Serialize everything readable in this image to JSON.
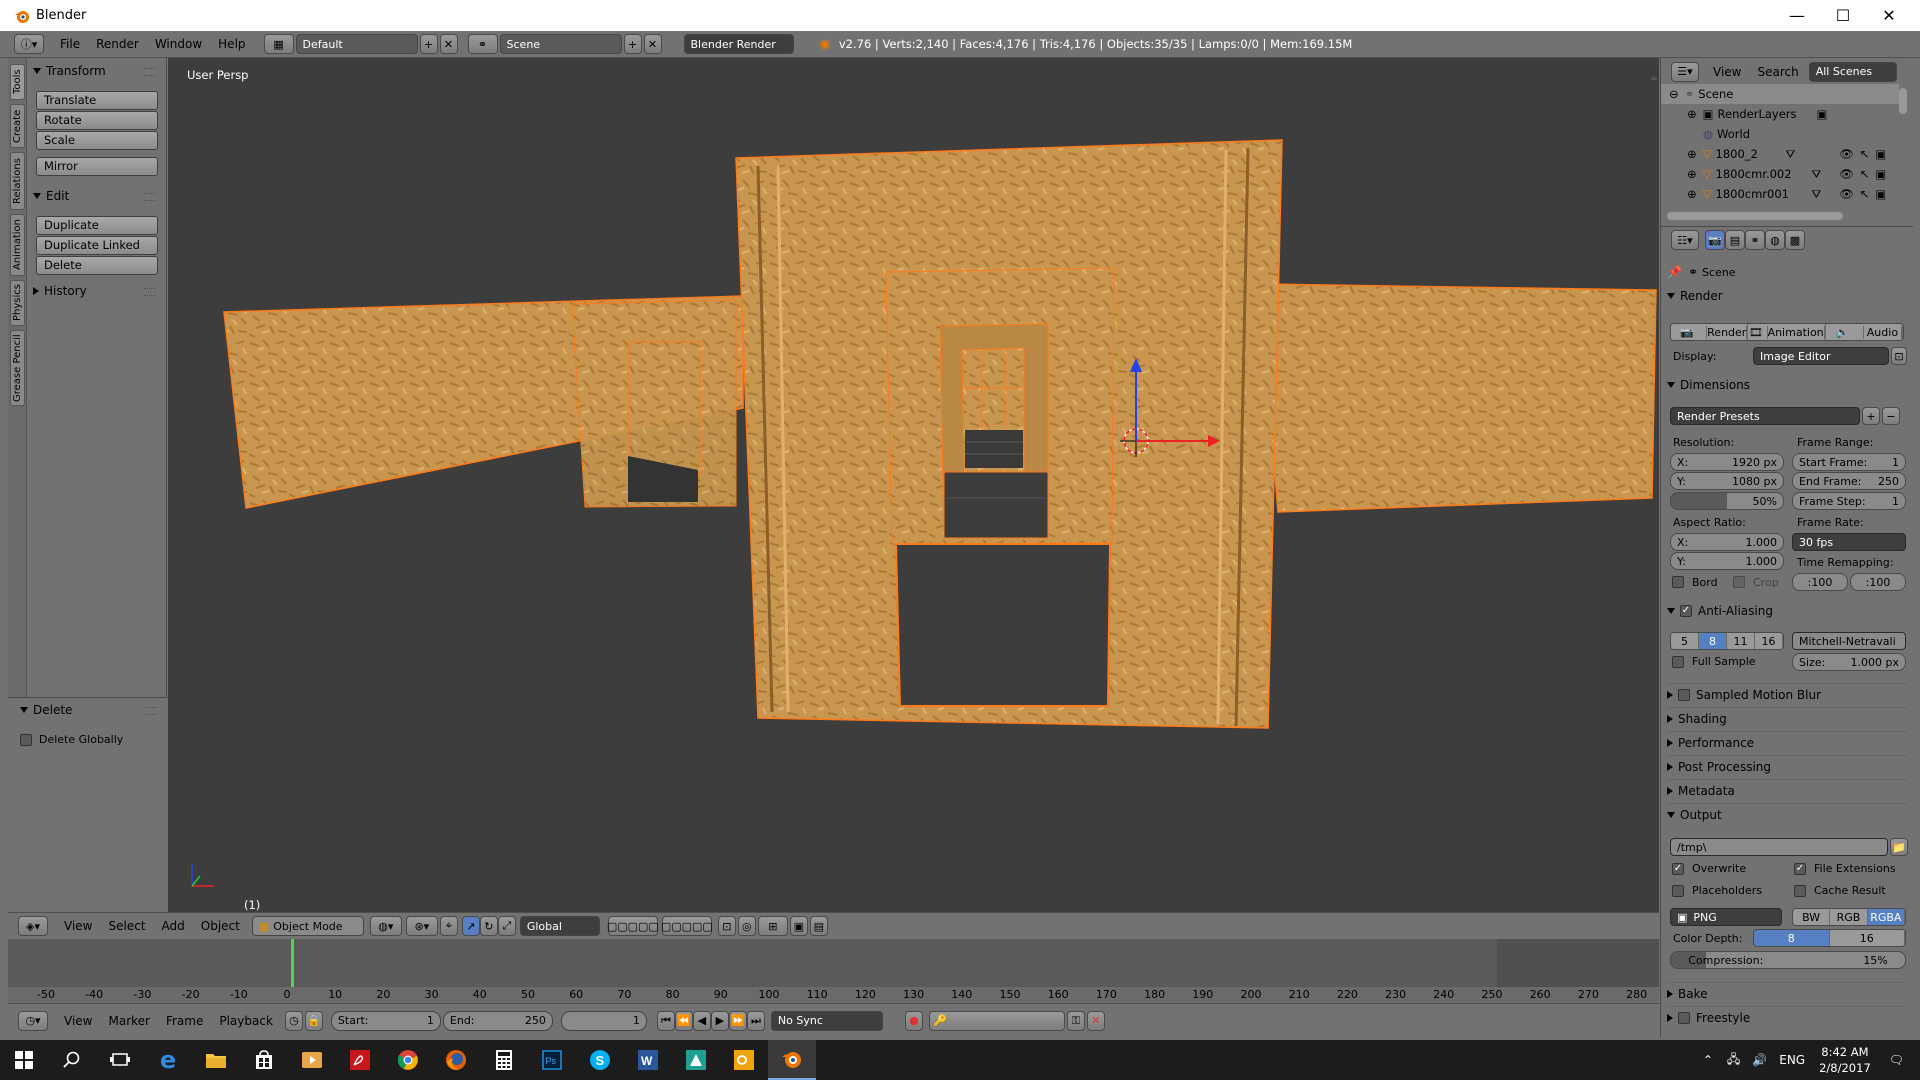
{
  "window": {
    "title": "Blender",
    "minimize": "—",
    "maximize": "☐",
    "close": "✕"
  },
  "info_header": {
    "menus": [
      "File",
      "Render",
      "Window",
      "Help"
    ],
    "layout": "Default",
    "scene": "Scene",
    "engine": "Blender Render",
    "stats": "v2.76 | Verts:2,140 | Faces:4,176 | Tris:4,176 | Objects:35/35 | Lamps:0/0 | Mem:169.15M"
  },
  "tool_tabs": [
    "Tools",
    "Create",
    "Relations",
    "Animation",
    "Physics",
    "Grease Pencil"
  ],
  "toolshelf": {
    "transform_title": "Transform",
    "transform_buttons": [
      "Translate",
      "Rotate",
      "Scale"
    ],
    "mirror": "Mirror",
    "edit_title": "Edit",
    "edit_buttons": [
      "Duplicate",
      "Duplicate Linked",
      "Delete"
    ],
    "history_title": "History",
    "operator_title": "Delete",
    "operator_option": "Delete Globally"
  },
  "viewport": {
    "label": "User Persp",
    "frame": "(1)"
  },
  "view3d_header": {
    "menus": [
      "View",
      "Select",
      "Add",
      "Object"
    ],
    "mode": "Object Mode",
    "orientation": "Global"
  },
  "timeline": {
    "ticks": [
      "-50",
      "-40",
      "-30",
      "-20",
      "-10",
      "0",
      "10",
      "20",
      "30",
      "40",
      "50",
      "60",
      "70",
      "80",
      "90",
      "100",
      "110",
      "120",
      "130",
      "140",
      "150",
      "160",
      "170",
      "180",
      "190",
      "200",
      "210",
      "220",
      "230",
      "240",
      "250",
      "260",
      "270",
      "280"
    ],
    "menus": [
      "View",
      "Marker",
      "Frame",
      "Playback"
    ],
    "start_label": "Start:",
    "start": "1",
    "end_label": "End:",
    "end": "250",
    "current": "1",
    "sync": "No Sync"
  },
  "outliner": {
    "menus": [
      "View",
      "Search"
    ],
    "filter": "All Scenes",
    "items": [
      "Scene",
      "RenderLayers",
      "World",
      "1800_2",
      "1800cmr.002",
      "1800cmr001"
    ]
  },
  "properties": {
    "context": "Scene",
    "render_title": "Render",
    "render_buttons": [
      "Render",
      "Animation",
      "Audio"
    ],
    "display_label": "Display:",
    "display_value": "Image Editor",
    "dimensions_title": "Dimensions",
    "render_presets": "Render Presets",
    "resolution_label": "Resolution:",
    "res_x_label": "X:",
    "res_x": "1920 px",
    "res_y_label": "Y:",
    "res_y": "1080 px",
    "res_pct": "50%",
    "frame_range_label": "Frame Range:",
    "start_frame_label": "Start Frame:",
    "start_frame": "1",
    "end_frame_label": "End Frame:",
    "end_frame": "250",
    "frame_step_label": "Frame Step:",
    "frame_step": "1",
    "aspect_label": "Aspect Ratio:",
    "aspect_x_label": "X:",
    "aspect_x": "1.000",
    "aspect_y_label": "Y:",
    "aspect_y": "1.000",
    "frame_rate_label": "Frame Rate:",
    "frame_rate": "30 fps",
    "time_remap_label": "Time Remapping:",
    "remap_old": "100",
    "remap_new": "100",
    "bord": "Bord",
    "crop": "Crop",
    "aa_title": "Anti-Aliasing",
    "aa_samples": [
      "5",
      "8",
      "11",
      "16"
    ],
    "aa_filter": "Mitchell-Netravali",
    "full_sample": "Full Sample",
    "size_label": "Size:",
    "size": "1.000 px",
    "collapsed": [
      "Sampled Motion Blur",
      "Shading",
      "Performance",
      "Post Processing",
      "Metadata"
    ],
    "output_title": "Output",
    "output_path": "/tmp\\",
    "overwrite": "Overwrite",
    "file_ext": "File Extensions",
    "placeholders": "Placeholders",
    "cache_result": "Cache Result",
    "format": "PNG",
    "color_modes": [
      "BW",
      "RGB",
      "RGBA"
    ],
    "color_depth_label": "Color Depth:",
    "depth_8": "8",
    "depth_16": "16",
    "compression_label": "Compression:",
    "compression": "15%",
    "bake_title": "Bake",
    "freestyle_title": "Freestyle"
  },
  "taskbar": {
    "lang": "ENG",
    "time": "8:42 AM",
    "date": "2/8/2017"
  }
}
